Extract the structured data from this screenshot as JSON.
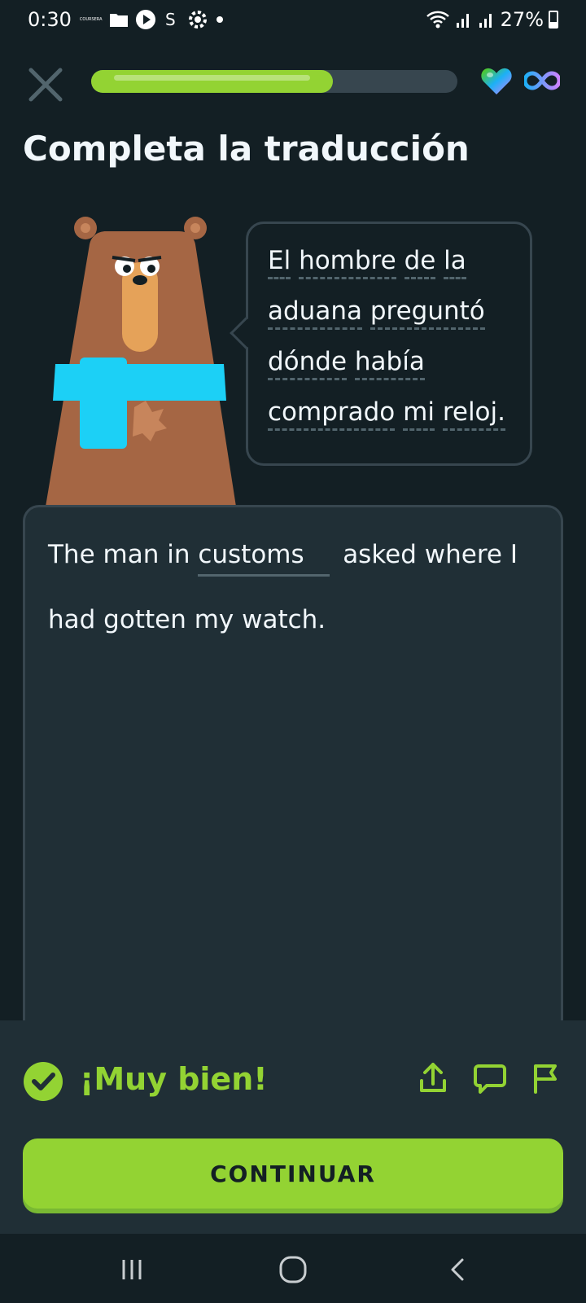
{
  "status_bar": {
    "time": "0:30",
    "mini_label": "COURSERA",
    "battery_percent": "27%"
  },
  "progress": {
    "fraction": 0.66
  },
  "header": {
    "title": "Completa la traducción"
  },
  "prompt": {
    "lines": [
      [
        "El",
        "hombre",
        "de",
        "la"
      ],
      [
        "aduana",
        "preguntó"
      ],
      [
        "dónde",
        "había"
      ],
      [
        "comprado",
        "mi",
        "reloj."
      ]
    ]
  },
  "answer": {
    "before": "The man in",
    "input_value": "customs",
    "after": "asked where I had gotten my watch."
  },
  "feedback": {
    "title": "¡Muy bien!"
  },
  "actions": {
    "continue_label": "CONTINUAR"
  },
  "colors": {
    "accent_green": "#93d333",
    "background": "#131f24",
    "panel": "#202f36",
    "border": "#37464f",
    "bear_fur": "#a56644",
    "scarf": "#1cb0f6"
  }
}
